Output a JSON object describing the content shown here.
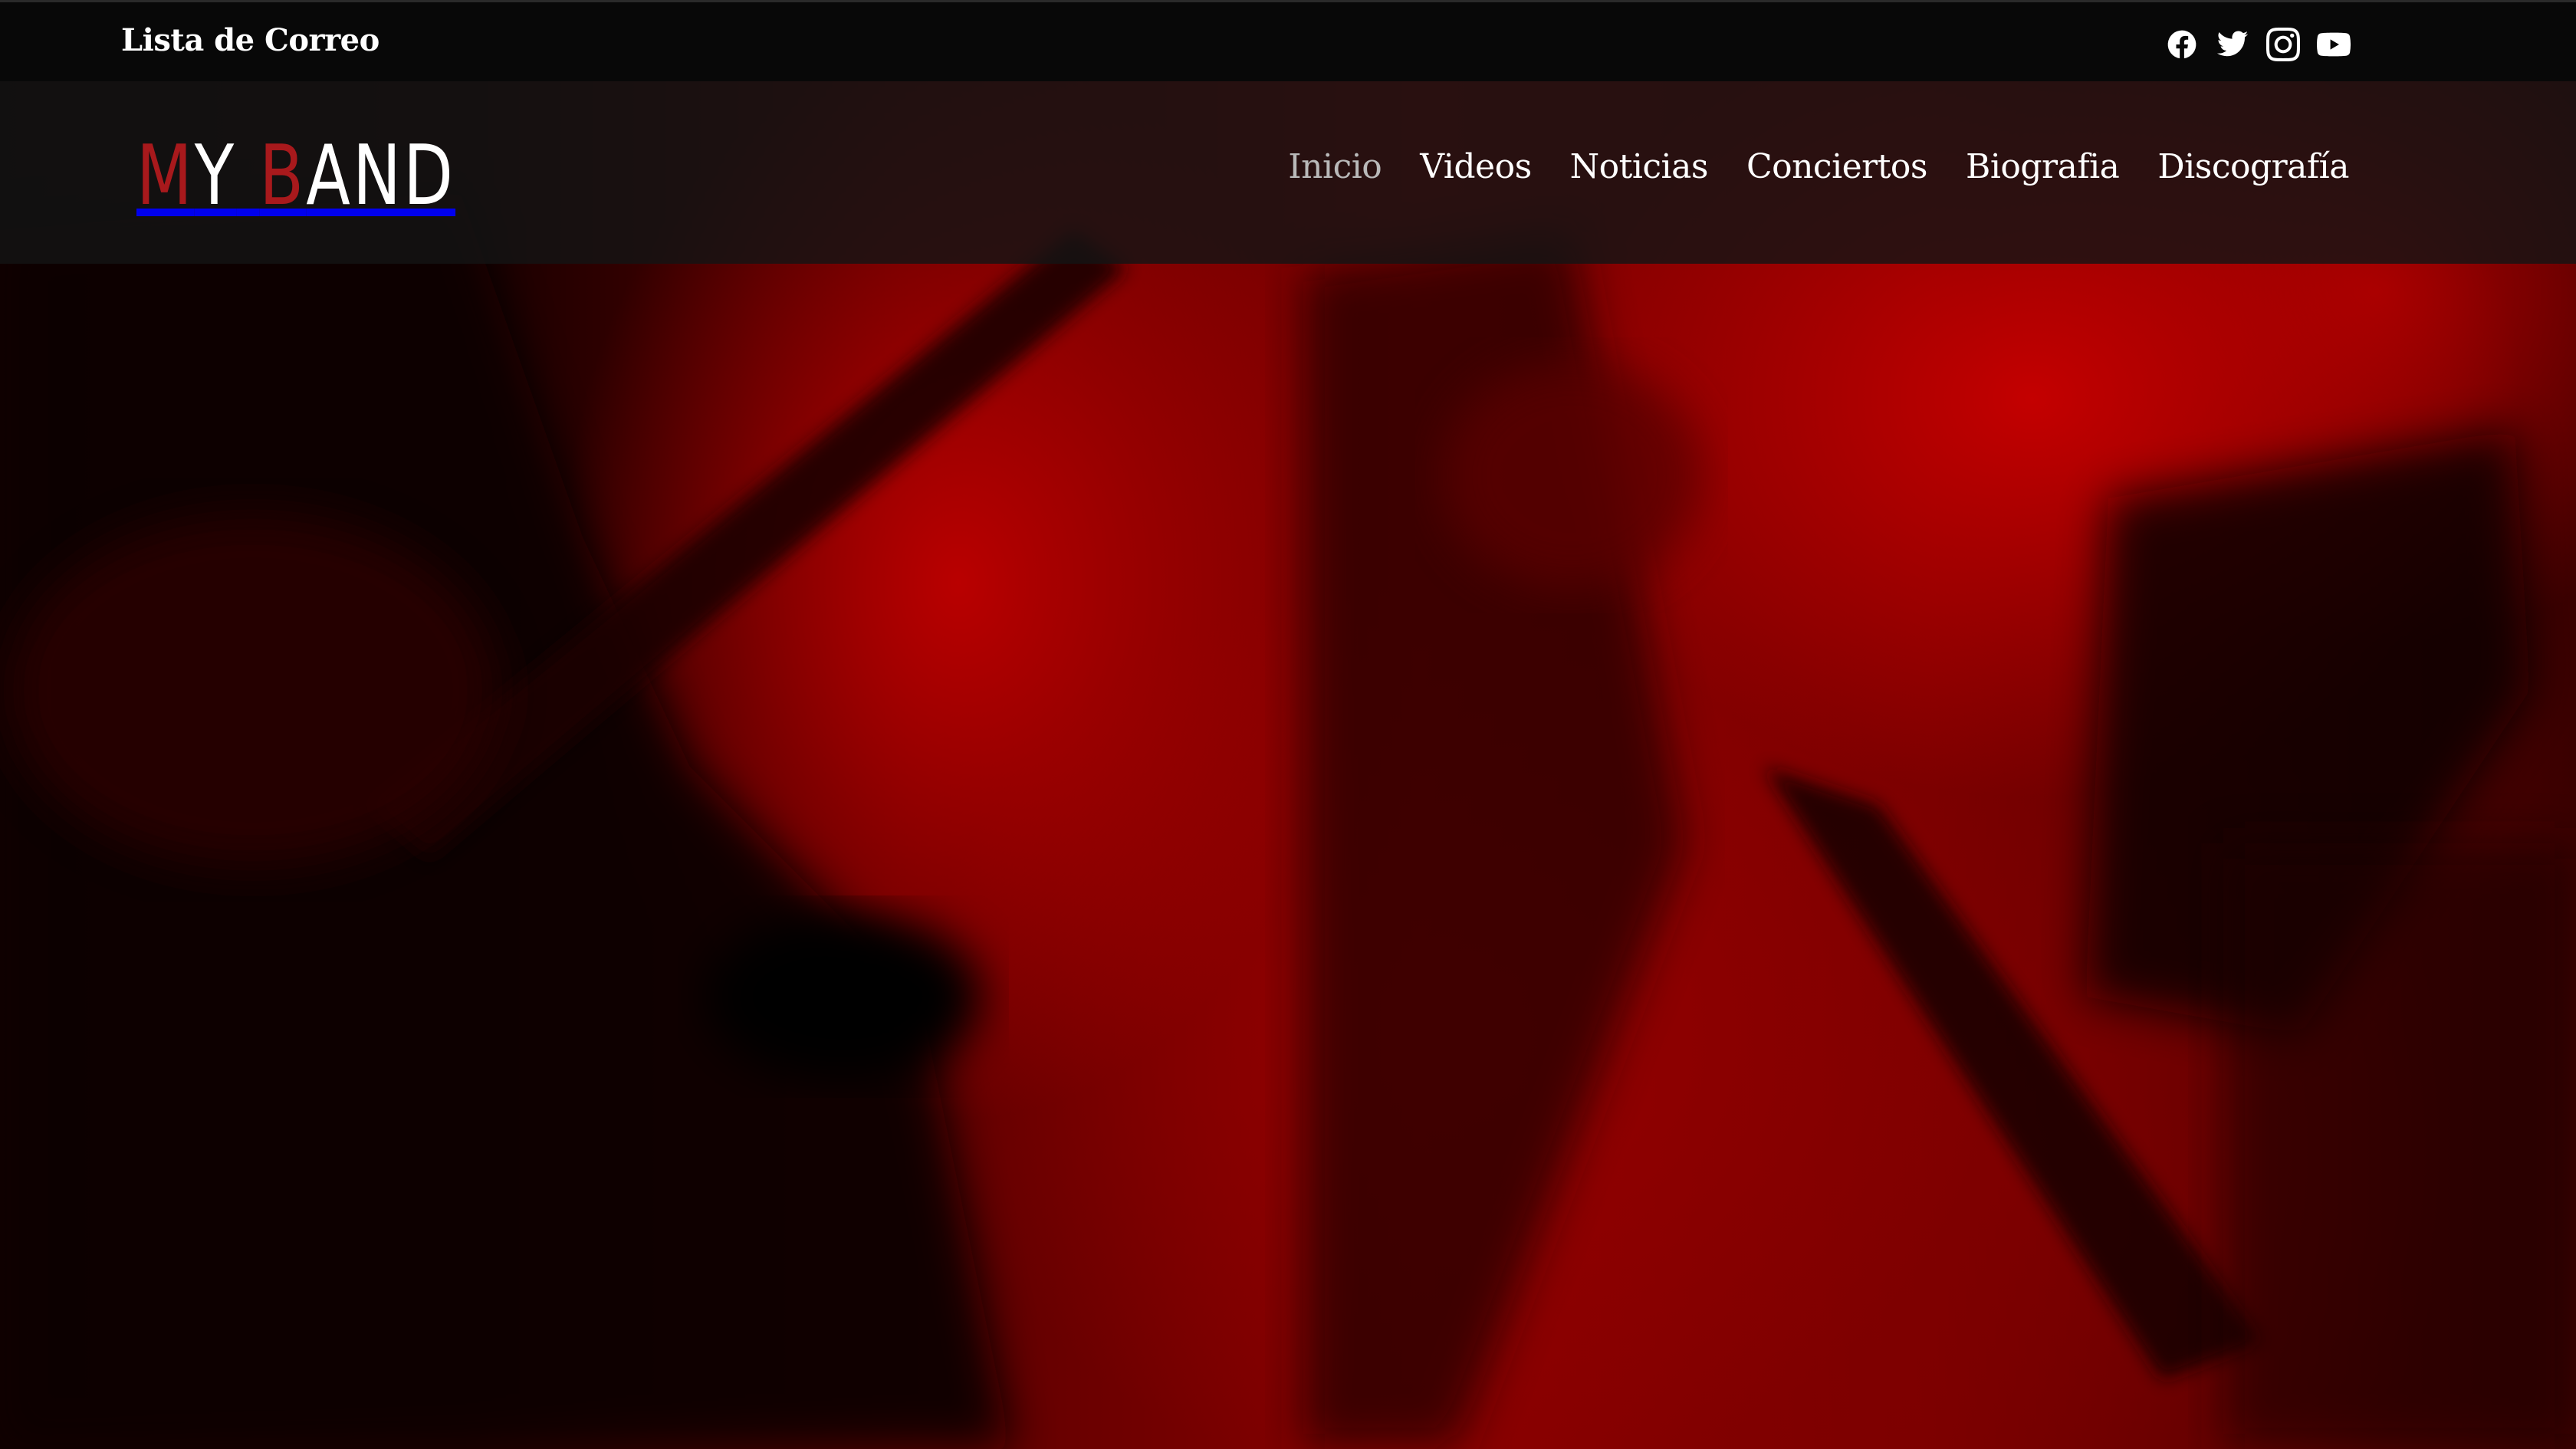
{
  "topbar": {
    "mailing_list_label": "Lista de Correo",
    "social": [
      {
        "name": "facebook-icon"
      },
      {
        "name": "twitter-icon"
      },
      {
        "name": "instagram-icon"
      },
      {
        "name": "youtube-icon"
      }
    ]
  },
  "header": {
    "logo": {
      "part1_red": "M",
      "part1_white": "Y",
      "part2_red": "B",
      "part2_white": "AND"
    },
    "nav": {
      "items": [
        {
          "label": "Inicio",
          "active": true
        },
        {
          "label": "Videos",
          "active": false
        },
        {
          "label": "Noticias",
          "active": false
        },
        {
          "label": "Conciertos",
          "active": false
        },
        {
          "label": "Biografia",
          "active": false
        },
        {
          "label": "Discografía",
          "active": false
        }
      ]
    }
  },
  "colors": {
    "logo_red": "#a8191c",
    "nav_active": "#b9b9b9",
    "hero_red": "#8a0000"
  }
}
